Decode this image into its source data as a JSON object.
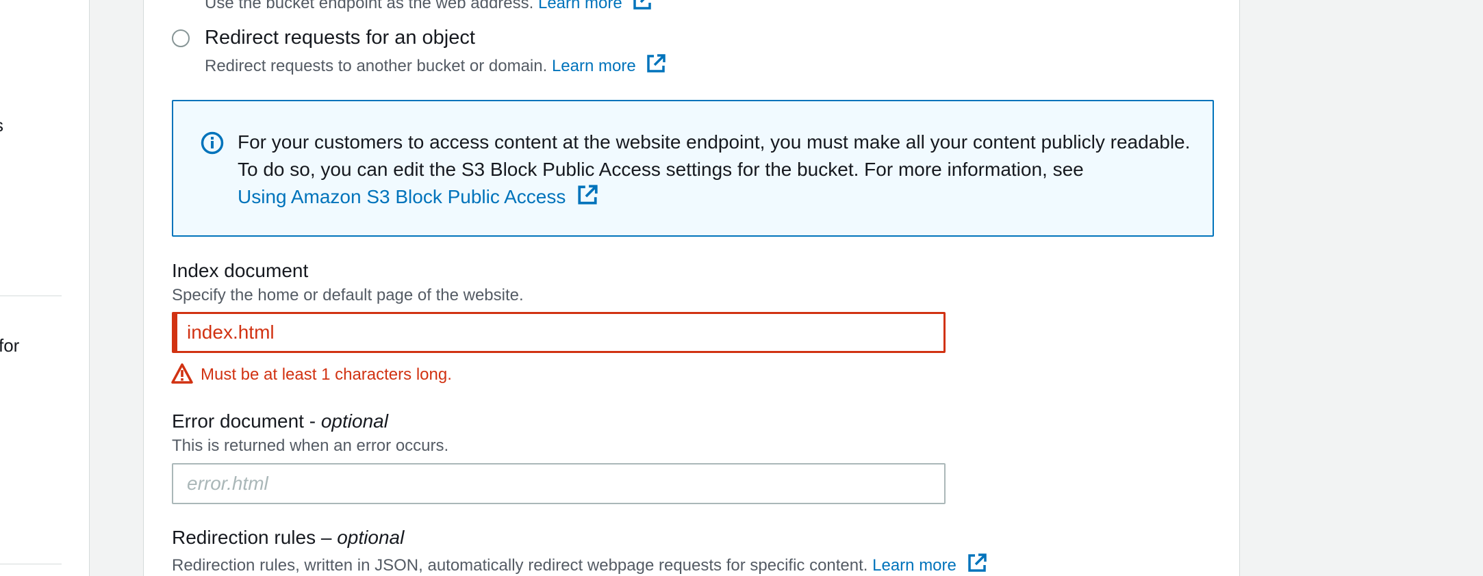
{
  "sidebar": {
    "fragments": [
      "s",
      "for"
    ]
  },
  "static_hosting_option": {
    "description": "Use the bucket endpoint as the web address.",
    "learn_more": "Learn more"
  },
  "redirect_option": {
    "label": "Redirect requests for an object",
    "description": "Redirect requests to another bucket or domain.",
    "learn_more": "Learn more",
    "selected": false
  },
  "info_alert": {
    "text": "For your customers to access content at the website endpoint, you must make all your content publicly readable. To do so, you can edit the S3 Block Public Access settings for the bucket. For more information, see",
    "link": "Using Amazon S3 Block Public Access",
    "icon": "info-icon"
  },
  "index_document": {
    "label": "Index document",
    "description": "Specify the home or default page of the website.",
    "value": "index.html",
    "error": "Must be at least 1 characters long."
  },
  "error_document": {
    "label": "Error document - ",
    "optional": "optional",
    "description": "This is returned when an error occurs.",
    "placeholder": "error.html"
  },
  "redirection_rules": {
    "label": "Redirection rules – ",
    "optional": "optional",
    "description": "Redirection rules, written in JSON, automatically redirect webpage requests for specific content.",
    "learn_more": "Learn more"
  },
  "colors": {
    "link": "#0073bb",
    "error": "#d13212",
    "info_bg": "#f1faff"
  }
}
